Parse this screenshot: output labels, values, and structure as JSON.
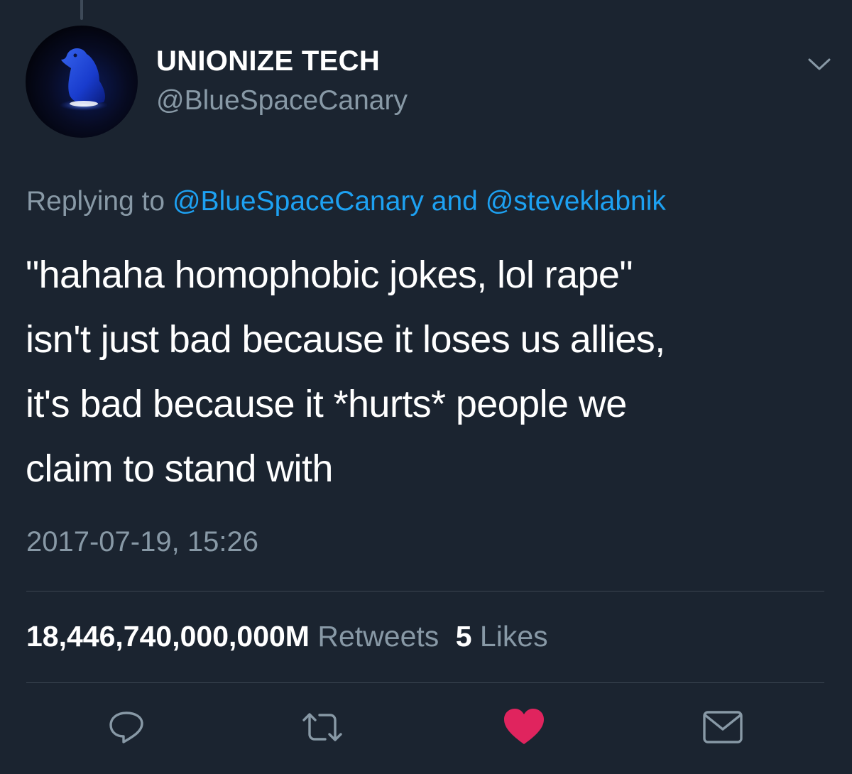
{
  "tweet": {
    "display_name": "UNIONIZE TECH",
    "handle": "@BlueSpaceCanary",
    "reply": {
      "prefix": "Replying to",
      "mention_1": "@BlueSpaceCanary",
      "joiner": "and",
      "mention_2": "@steveklabnik"
    },
    "text": "\"hahaha homophobic jokes, lol rape\"\nisn't just bad because it loses us allies,\nit's bad because it *hurts* people we\nclaim to stand with",
    "timestamp": "2017-07-19, 15:26",
    "retweets_count": "18,446,740,000,000M",
    "retweets_label": "Retweets",
    "likes_count": "5",
    "likes_label": "Likes"
  },
  "icons": {
    "menu": "chevron-down-icon",
    "reply": "reply-icon",
    "retweet": "retweet-icon",
    "like": "heart-icon",
    "message": "envelope-icon"
  },
  "colors": {
    "background": "#1b2430",
    "link": "#1da1f2",
    "secondary_text": "#8899a6",
    "like_active": "#e0245e"
  }
}
